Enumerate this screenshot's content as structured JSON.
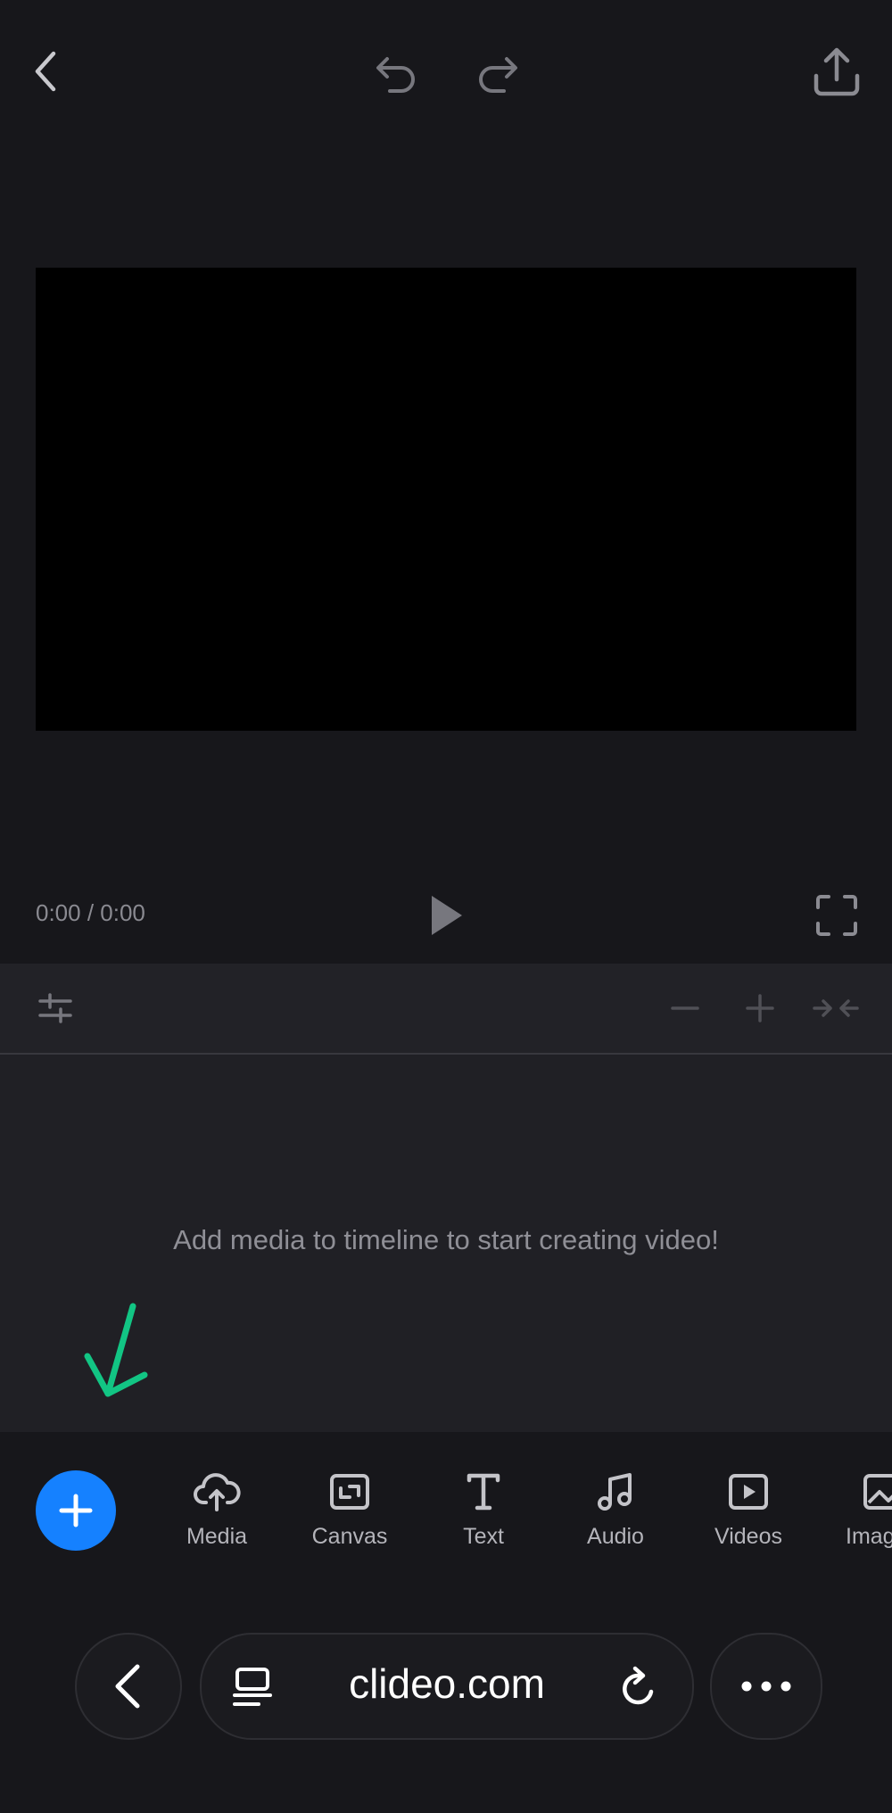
{
  "header": {
    "back_icon": "chevron-left-icon",
    "undo_icon": "undo-icon",
    "redo_icon": "redo-icon",
    "export_icon": "upload-icon"
  },
  "player": {
    "time": "0:00 / 0:00",
    "play_icon": "play-icon",
    "fullscreen_icon": "fullscreen-icon"
  },
  "timeline_toolbar": {
    "settings_icon": "sliders-icon",
    "zoom_out_icon": "minus-icon",
    "zoom_in_icon": "plus-icon",
    "fit_icon": "collapse-icon"
  },
  "timeline": {
    "empty_message": "Add media to timeline to start creating video!",
    "hint_arrow_color": "#12c584"
  },
  "tools": {
    "add_icon": "plus-icon",
    "accent": "#1581ff",
    "items": [
      {
        "label": "Media",
        "icon": "cloud-upload-icon"
      },
      {
        "label": "Canvas",
        "icon": "canvas-icon"
      },
      {
        "label": "Text",
        "icon": "text-icon"
      },
      {
        "label": "Audio",
        "icon": "music-note-icon"
      },
      {
        "label": "Videos",
        "icon": "video-icon"
      },
      {
        "label": "Imag",
        "icon": "image-icon"
      }
    ]
  },
  "browser": {
    "url": "clideo.com",
    "back_icon": "chevron-left-icon",
    "tabs_icon": "page-icon",
    "reload_icon": "reload-icon",
    "more_icon": "more-icon"
  }
}
